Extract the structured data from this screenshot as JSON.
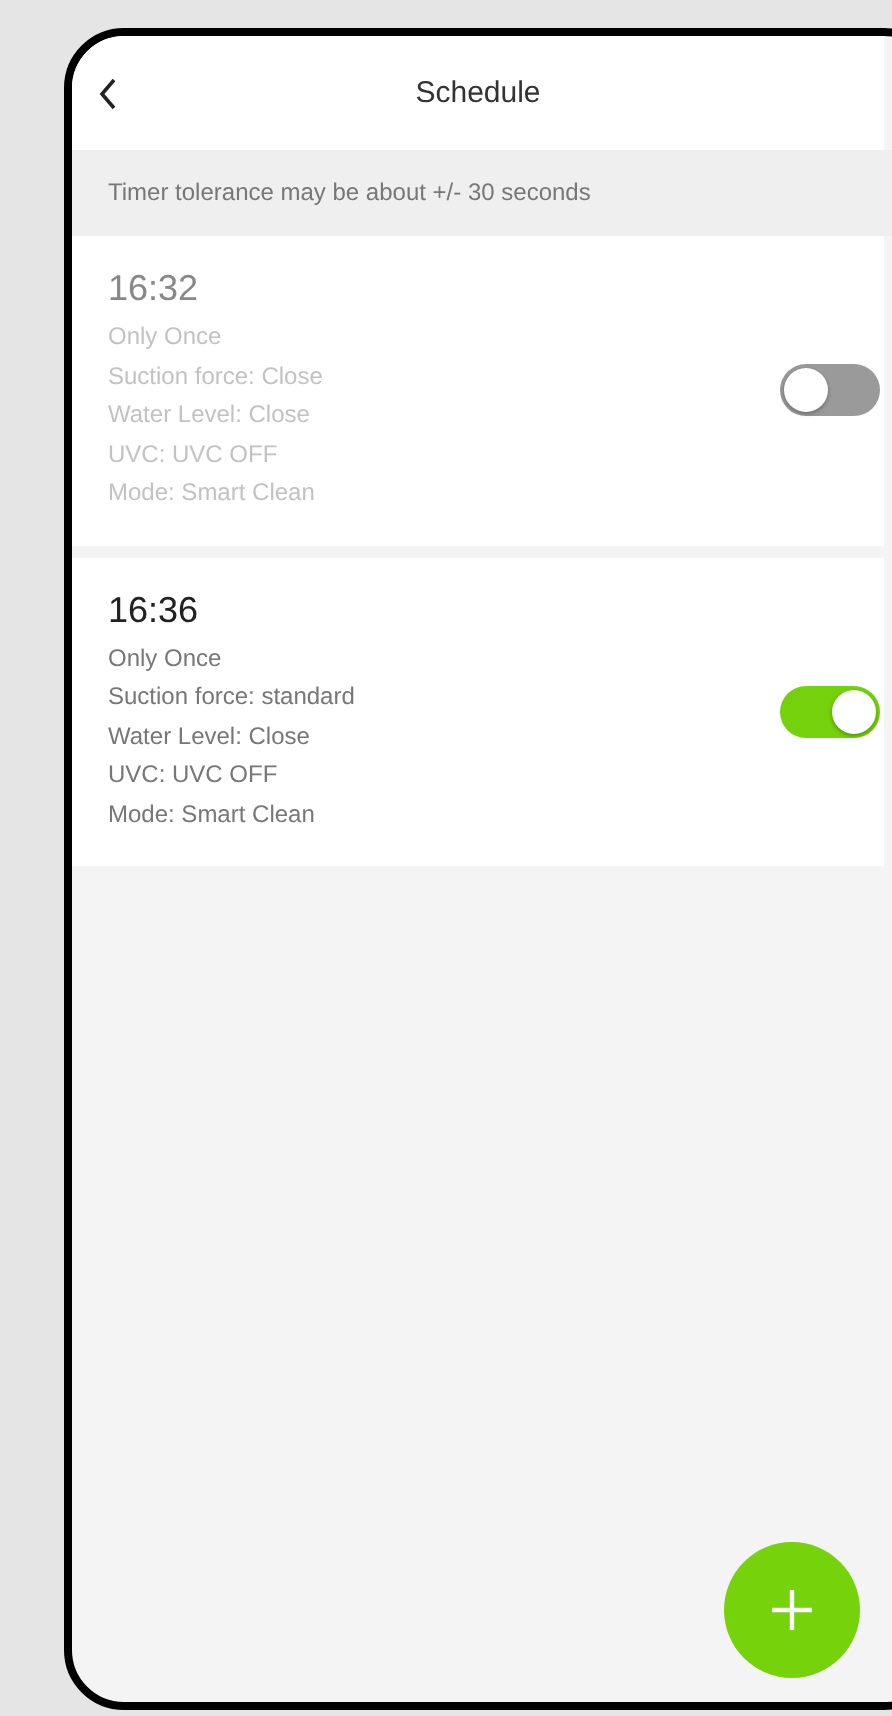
{
  "header": {
    "title": "Schedule"
  },
  "notice": "Timer tolerance may be about +/- 30 seconds",
  "timers": [
    {
      "time": "16:32",
      "details": [
        "Only Once",
        "Suction force: Close",
        "Water Level: Close",
        "UVC: UVC OFF",
        "Mode: Smart Clean"
      ],
      "on": false
    },
    {
      "time": "16:36",
      "details": [
        "Only Once",
        "Suction force: standard",
        "Water Level: Close",
        "UVC: UVC OFF",
        "Mode: Smart Clean"
      ],
      "on": true
    }
  ]
}
